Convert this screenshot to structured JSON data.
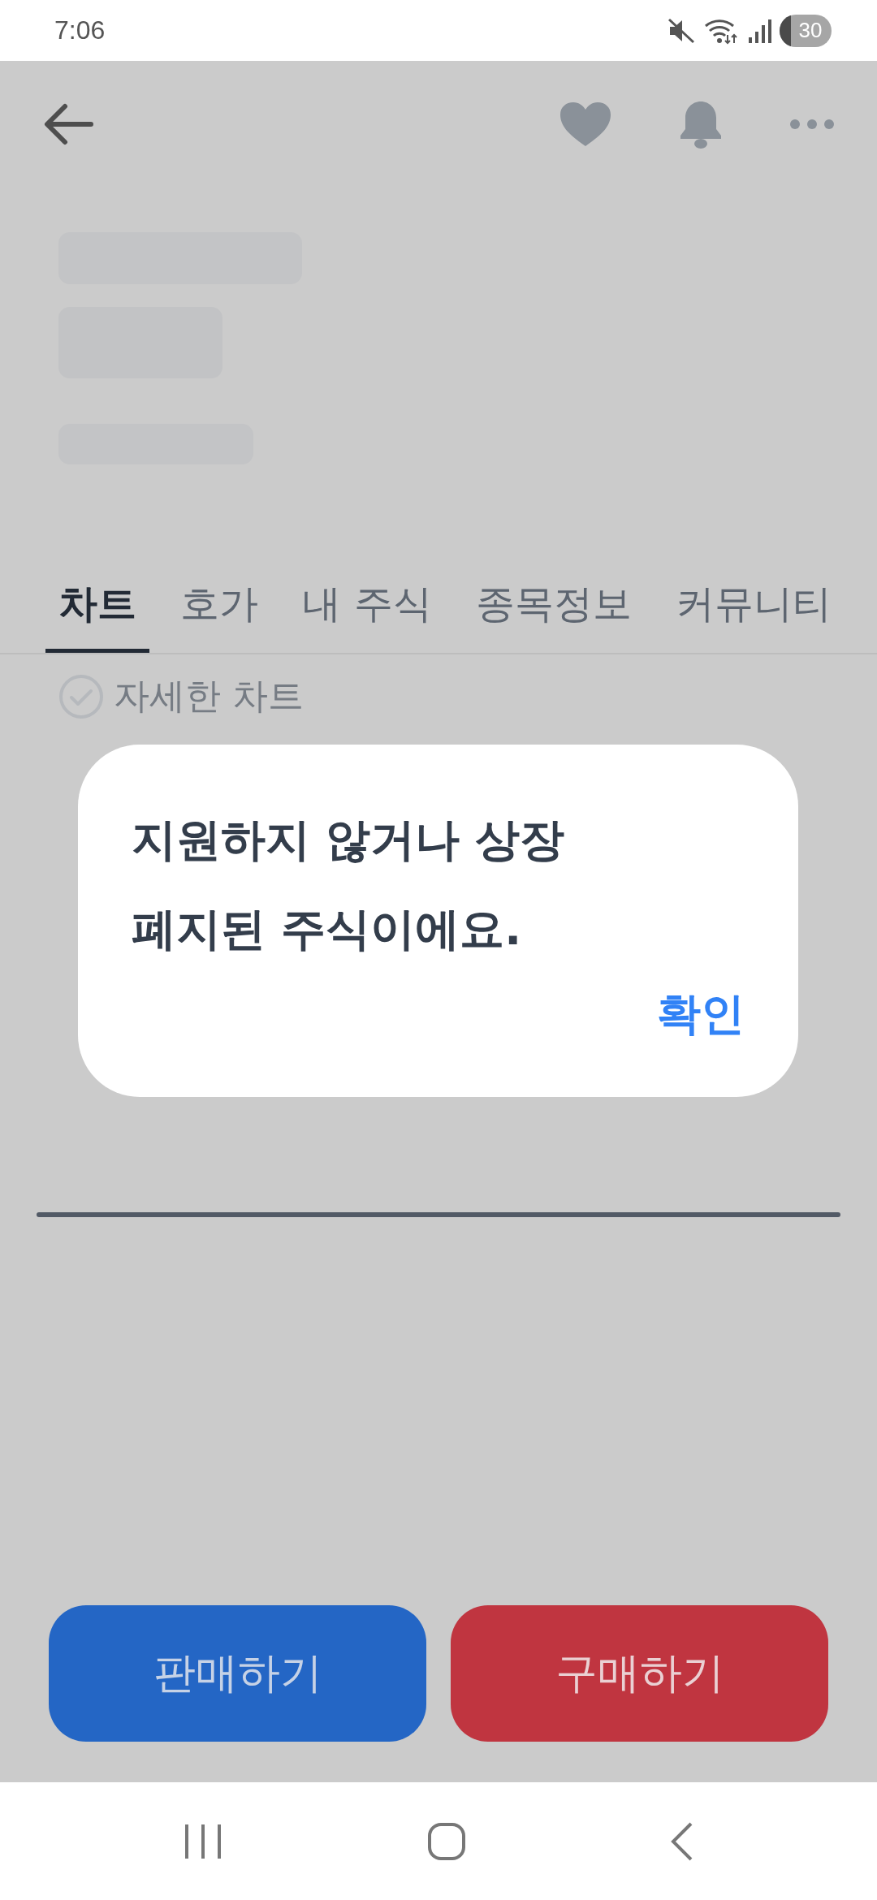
{
  "status_bar": {
    "time": "7:06",
    "battery": "30"
  },
  "tabs": [
    {
      "label": "차트",
      "selected": true
    },
    {
      "label": "호가",
      "selected": false
    },
    {
      "label": "내 주식",
      "selected": false
    },
    {
      "label": "종목정보",
      "selected": false
    },
    {
      "label": "커뮤니티",
      "selected": false
    }
  ],
  "detail_chart_toggle": {
    "label": "자세한 차트",
    "checked": false
  },
  "dialog": {
    "message": "지원하지 않거나 상장\n폐지된 주식이에요.",
    "confirm": "확인"
  },
  "actions": [
    {
      "label": "판매하기",
      "kind": "sell"
    },
    {
      "label": "구매하기",
      "kind": "buy"
    }
  ]
}
